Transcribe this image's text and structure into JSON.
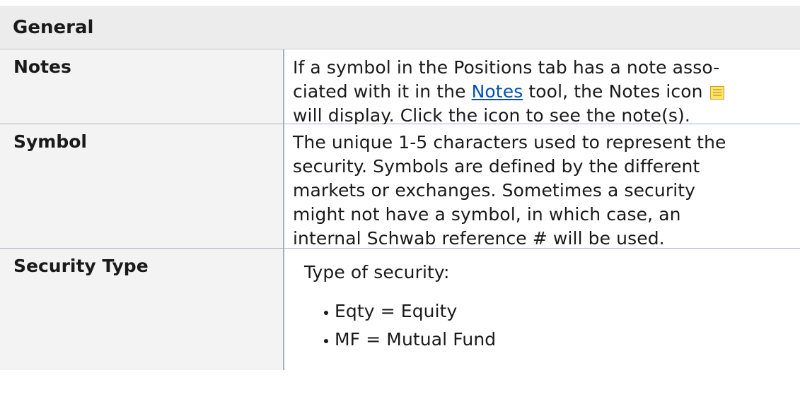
{
  "section": {
    "title": "General"
  },
  "rows": [
    {
      "term": "Notes",
      "desc_before": "If a symbol in the Positions tab has a note asso-",
      "desc_line2_before": "ciated with it in the ",
      "desc_link": "Notes",
      "desc_line2_after": " tool, the Notes icon",
      "desc_line3": "will display. Click the icon to see the note(s).",
      "icon": "notes-icon"
    },
    {
      "term": "Symbol",
      "desc_lines": [
        "The unique 1-5 characters used to represent the",
        "security. Symbols are defined by the different",
        "markets or exchanges. Sometimes a security",
        "might not have a symbol, in which case, an",
        "internal Schwab reference # will be used."
      ]
    },
    {
      "term": "Security Type",
      "desc": "Type of security:",
      "bullets": [
        "Eqty = Equity",
        "MF = Mutual Fund"
      ]
    }
  ],
  "colors": {
    "header_bg": "#ececec",
    "term_bg": "#f3f3f3",
    "border": "#a0b0c2",
    "link": "#0050b8",
    "icon_fill": "#ffe36b"
  }
}
